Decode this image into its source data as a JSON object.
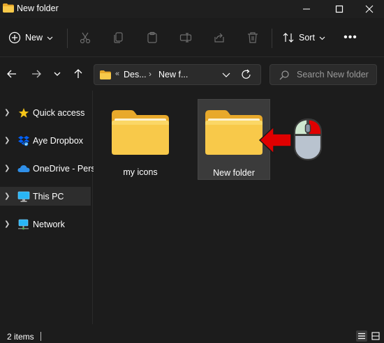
{
  "window": {
    "title": "New folder"
  },
  "toolbar": {
    "new_label": "New",
    "sort_label": "Sort",
    "more_label": "•••"
  },
  "address": {
    "prefix": "«",
    "segments": [
      "Des...",
      "New f..."
    ],
    "separator": "›"
  },
  "search": {
    "placeholder": "Search New folder"
  },
  "sidebar": {
    "items": [
      {
        "label": "Quick access",
        "icon": "star-icon"
      },
      {
        "label": "Aye Dropbox",
        "icon": "dropbox-icon"
      },
      {
        "label": "OneDrive - Pers",
        "icon": "onedrive-icon"
      },
      {
        "label": "This PC",
        "icon": "pc-icon",
        "selected": true
      },
      {
        "label": "Network",
        "icon": "network-icon"
      }
    ]
  },
  "content": {
    "items": [
      {
        "label": "my icons",
        "icon": "folder-icon"
      },
      {
        "label": "New folder",
        "icon": "folder-icon",
        "selected": true
      }
    ],
    "annotation": {
      "arrow_color": "#e00000",
      "mouse_icon": "mouse-right-click-icon"
    }
  },
  "status": {
    "item_count": "2 items"
  },
  "colors": {
    "folder_yellow": "#f8c94a",
    "background": "#1c1c1c",
    "selection": "#3b3b3b"
  }
}
